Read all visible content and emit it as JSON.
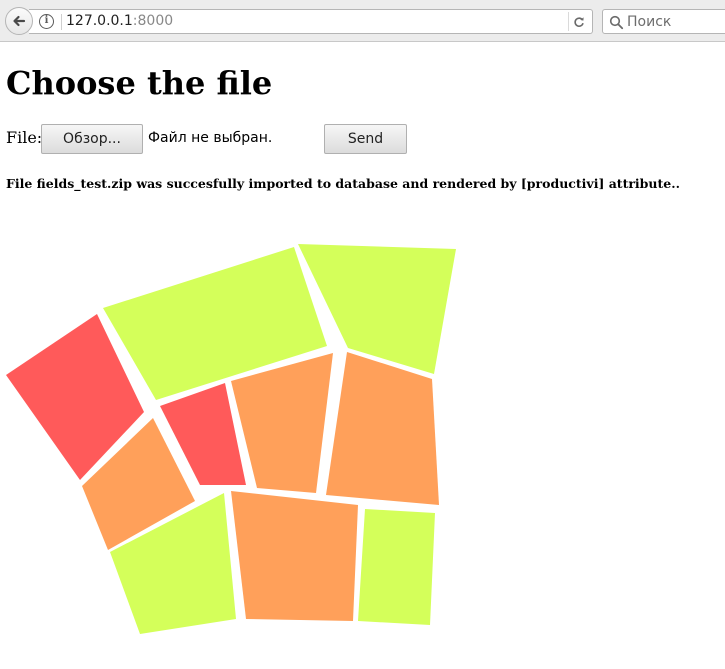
{
  "browser": {
    "url_host": "127.0.0.1",
    "url_port": ":8000",
    "search_placeholder": "Поиск"
  },
  "page": {
    "title": "Choose the file",
    "file_label": "File:",
    "browse_button": "Обзор...",
    "no_file_text": "Файл не выбран.",
    "send_button": "Send",
    "status_message": "File fields_test.zip was succesfully imported to database and rendered by [productivi] attribute.."
  },
  "field_map": {
    "colors": {
      "green": "#d4ff5a",
      "orange": "#ffa05a",
      "red": "#ff5a5a"
    },
    "fields": [
      {
        "name": "field-red-left",
        "color": "red"
      },
      {
        "name": "field-green-top-left",
        "color": "green"
      },
      {
        "name": "field-green-top-right",
        "color": "green"
      },
      {
        "name": "field-red-center",
        "color": "red"
      },
      {
        "name": "field-orange-center",
        "color": "orange"
      },
      {
        "name": "field-orange-right",
        "color": "orange"
      },
      {
        "name": "field-orange-left",
        "color": "orange"
      },
      {
        "name": "field-green-bottom-left",
        "color": "green"
      },
      {
        "name": "field-orange-bottom",
        "color": "orange"
      },
      {
        "name": "field-green-bottom-right",
        "color": "green"
      }
    ]
  }
}
